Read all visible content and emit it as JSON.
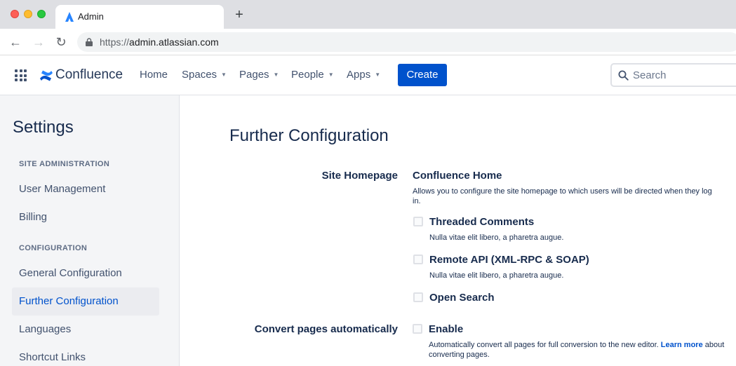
{
  "browser": {
    "tab_title": "Admin",
    "new_tab": "+",
    "url_scheme": "https://",
    "url_host": "admin.atlassian.com"
  },
  "header": {
    "product": "Confluence",
    "nav": [
      {
        "label": "Home"
      },
      {
        "label": "Spaces"
      },
      {
        "label": "Pages"
      },
      {
        "label": "People"
      },
      {
        "label": "Apps"
      }
    ],
    "create_label": "Create",
    "search_placeholder": "Search",
    "accent_color": "#0052cc"
  },
  "sidebar": {
    "title": "Settings",
    "sections": [
      {
        "heading": "SITE ADMINISTRATION",
        "items": [
          {
            "label": "User Management",
            "active": false
          },
          {
            "label": "Billing",
            "active": false
          }
        ]
      },
      {
        "heading": "CONFIGURATION",
        "items": [
          {
            "label": "General Configuration",
            "active": false
          },
          {
            "label": "Further Configuration",
            "active": true
          },
          {
            "label": "Languages",
            "active": false
          },
          {
            "label": "Shortcut Links",
            "active": false
          }
        ]
      }
    ]
  },
  "main": {
    "title": "Further Configuration",
    "site_homepage": {
      "label": "Site Homepage",
      "value": "Confluence Home",
      "description": "Allows you to configure the site homepage to which users will be directed when they log in."
    },
    "options": [
      {
        "label": "Threaded Comments",
        "description": "Nulla vitae elit libero, a pharetra augue.",
        "checked": false
      },
      {
        "label": "Remote API (XML-RPC & SOAP)",
        "description": "Nulla vitae elit libero, a pharetra augue.",
        "checked": false
      },
      {
        "label": "Open Search",
        "description": "",
        "checked": false
      }
    ],
    "convert_pages": {
      "label": "Convert pages automatically",
      "option_label": "Enable",
      "checked": false,
      "description": "Automatically convert all pages for full conversion to the new editor.",
      "link_text": "Learn more",
      "description_tail": "about converting pages."
    }
  }
}
